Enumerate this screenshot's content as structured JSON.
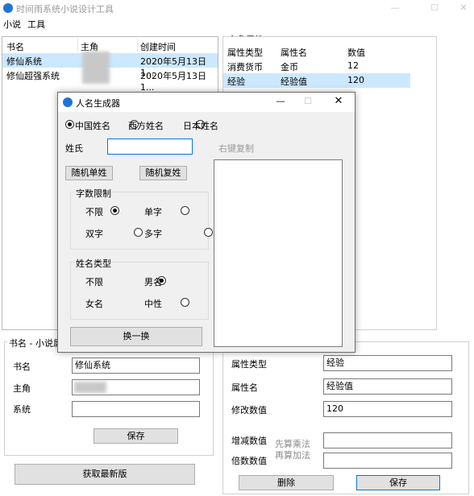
{
  "window": {
    "title": "时间雨系统小说设计工具",
    "min": "—",
    "max": "☐",
    "close": "✕"
  },
  "menu": [
    "小说",
    "工具"
  ],
  "book_table": {
    "headers": [
      "书名",
      "主角",
      "创建时间"
    ],
    "rows": [
      {
        "name": "修仙系统",
        "created": "2020年5月13日1..."
      },
      {
        "name": "修仙超强系统",
        "created": "2020年5月13日1..."
      }
    ]
  },
  "hero_attrs": {
    "title": "主角属性",
    "headers": [
      "属性类型",
      "属性名",
      "数值"
    ],
    "rows": [
      {
        "type": "消费货币",
        "name": "金币",
        "value": "12"
      },
      {
        "type": "经验",
        "name": "经验值",
        "value": "120"
      }
    ]
  },
  "book_form": {
    "group_label": "书名 - 小说属性",
    "name_label": "书名",
    "name_value": "修仙系统",
    "hero_label": "主角",
    "system_label": "系统",
    "system_value": "",
    "save": "保存",
    "latest": "获取最新版"
  },
  "attr_form": {
    "type_label": "属性类型",
    "type_value": "经验",
    "name_label": "属性名",
    "name_value": "经验值",
    "modify_label": "修改数值",
    "modify_value": "120",
    "add_label": "增减数值",
    "mul_label": "倍数数值",
    "hint1": "先算乘法",
    "hint2": "再算加法",
    "delete": "删除",
    "save": "保存"
  },
  "dialog": {
    "title": "人名生成器",
    "min": "—",
    "max": "☐",
    "close": "✕",
    "origin": [
      "中国姓名",
      "西方姓名",
      "日本姓名"
    ],
    "surname_label": "姓氏",
    "copy_hint": "右键复制",
    "random_single": "随机单姓",
    "random_double": "随机复姓",
    "count_group": "字数限制",
    "count_opts": [
      "不限",
      "单字",
      "双字",
      "多字"
    ],
    "type_group": "姓名类型",
    "type_opts": [
      "不限",
      "男名",
      "女名",
      "中性"
    ],
    "refresh": "换一换"
  },
  "colors": {
    "selection": "#cce8ff",
    "app_icon": "#1e74d6",
    "dialog_bg": "#f0f0f0"
  }
}
